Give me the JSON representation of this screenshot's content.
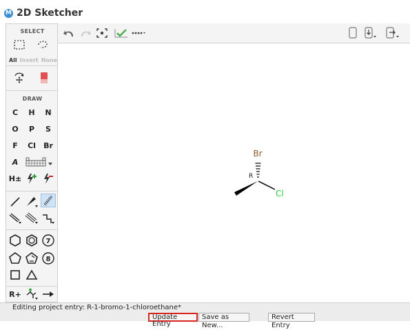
{
  "app": {
    "icon_letter": "M",
    "title": "2D Sketcher"
  },
  "palette": {
    "select_label": "SELECT",
    "select_links": [
      "All",
      "Invert",
      "None"
    ],
    "draw_label": "DRAW",
    "elements": [
      "C",
      "H",
      "N",
      "O",
      "P",
      "S",
      "F",
      "Cl",
      "Br"
    ],
    "atom_a_label": "A",
    "hydrogen_label": "H±",
    "rgroup_label": "R+",
    "ring7_label": "7",
    "ring8_label": "8"
  },
  "canvas": {
    "molecule": {
      "atom_labels": {
        "br": "Br",
        "cl": "Cl",
        "stereo": "R"
      },
      "colors": {
        "br": "#8B5A2B",
        "cl": "#2ecc40",
        "bond": "#000000"
      }
    }
  },
  "status": {
    "text": "Editing project entry: R-1-bromo-1-chloroethane*"
  },
  "buttons": {
    "update": "Update Entry",
    "save_new": "Save as New...",
    "revert": "Revert Entry"
  },
  "colors": {
    "accent_check": "#4caf50",
    "highlight_border": "#d9231f",
    "eraser": "#e05050"
  }
}
